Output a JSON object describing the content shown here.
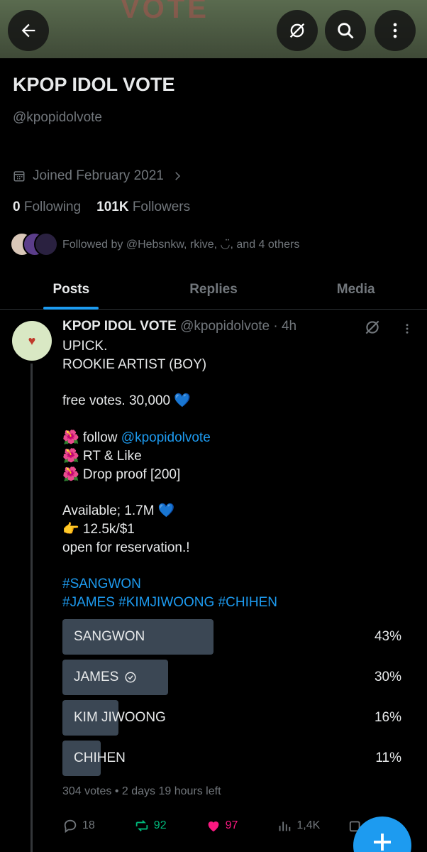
{
  "banner": {
    "art_text": "VOTE"
  },
  "profile": {
    "name": "KPOP IDOL VOTE",
    "handle": "@kpopidolvote",
    "joined": "Joined February 2021",
    "following_count": "0",
    "following_label": "Following",
    "followers_count": "101K",
    "followers_label": "Followers",
    "followed_by": "Followed by @Hebsnkw, rkive, ◡̈, and 4 others"
  },
  "tabs": [
    {
      "label": "Posts"
    },
    {
      "label": "Replies"
    },
    {
      "label": "Media"
    }
  ],
  "post": {
    "author": "KPOP IDOL VOTE",
    "meta": "@kpopidolvote · 4h",
    "lines": [
      "UPICK.",
      "ROOKIE ARTIST (BOY)",
      "",
      "free votes. 30,000 💙",
      "",
      "🌺 follow ",
      "🌺 RT & Like",
      "🌺 Drop proof [200]",
      "",
      "Available; 1.7M 💙",
      "👉 12.5k/$1",
      "open for reservation.!",
      ""
    ],
    "mention": "@kpopidolvote",
    "hashtags_1": "#SANGWON",
    "hashtags_2": "#JAMES #KIMJIWOONG #CHIHEN"
  },
  "poll": {
    "options": [
      {
        "label": "SANGWON",
        "pct_text": "43%",
        "pct": 0.43,
        "checked": false
      },
      {
        "label": "JAMES",
        "pct_text": "30%",
        "pct": 0.3,
        "checked": true
      },
      {
        "label": "KIM JIWOONG",
        "pct_text": "16%",
        "pct": 0.16,
        "checked": false
      },
      {
        "label": "CHIHEN",
        "pct_text": "11%",
        "pct": 0.11,
        "checked": false
      }
    ],
    "meta": "304 votes • 2 days 19 hours left"
  },
  "actions": {
    "replies": "18",
    "reposts": "92",
    "likes": "97",
    "views": "1,4K"
  },
  "colors": {
    "accent": "#1d9bf0",
    "muted": "#71767b",
    "repost": "#00ba7c",
    "like": "#f91880",
    "poll_fill": "#3b4754"
  }
}
